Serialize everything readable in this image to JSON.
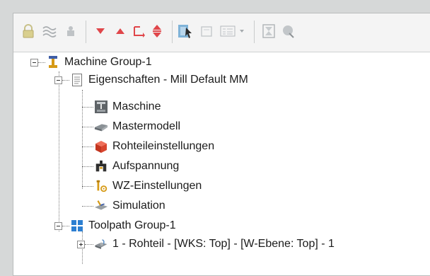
{
  "toolbar": {
    "buttons": [
      {
        "name": "lock-icon"
      },
      {
        "name": "wave-toggle-icon"
      },
      {
        "name": "hide-icon"
      },
      {
        "name": "arrow-down-icon"
      },
      {
        "name": "arrow-up-icon"
      },
      {
        "name": "insert-arrow-icon"
      },
      {
        "name": "move-updown-icon"
      },
      {
        "name": "select-icon"
      },
      {
        "name": "window-icon"
      },
      {
        "name": "list-icon"
      },
      {
        "name": "dropdown-icon"
      },
      {
        "name": "hourglass-icon"
      },
      {
        "name": "globe-icon"
      }
    ]
  },
  "tree": {
    "machine_group": "Machine Group-1",
    "properties": "Eigenschaften - Mill Default MM",
    "machine": "Maschine",
    "master_model": "Mastermodell",
    "stock_settings": "Rohteileinstellungen",
    "fixture": "Aufspannung",
    "tool_settings": "WZ-Einstellungen",
    "simulation": "Simulation",
    "toolpath_group": "Toolpath Group-1",
    "operation_1": "1 - Rohteil - [WKS: Top] - [W-Ebene: Top] - 1"
  },
  "colors": {
    "red_arrow": "#e0464a",
    "blue_icon": "#2d7fd1",
    "stock_red": "#d8452e",
    "gold": "#d69a16"
  }
}
